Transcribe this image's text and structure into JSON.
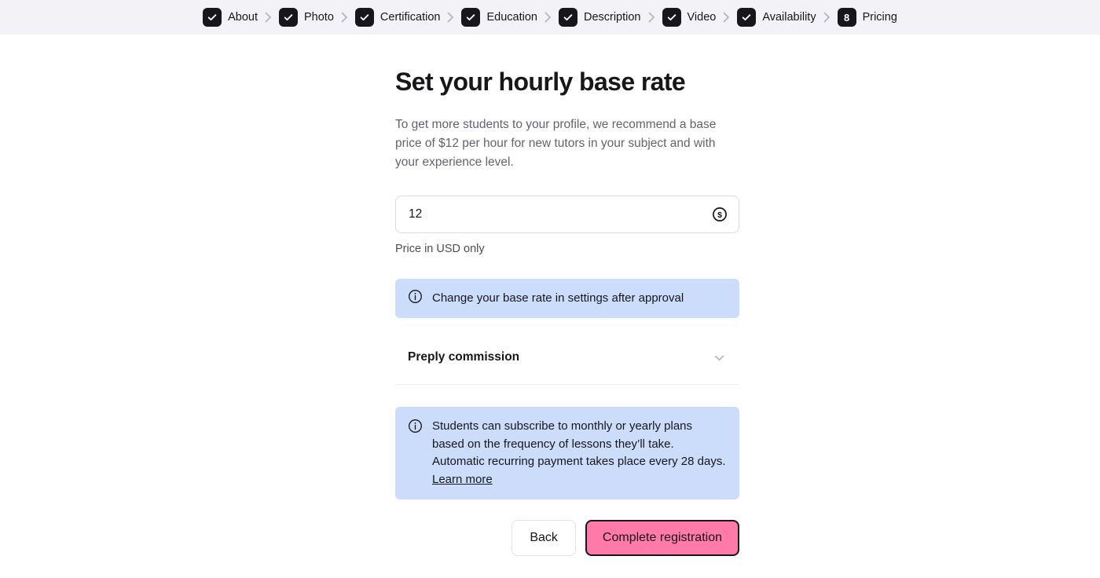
{
  "stepper": {
    "steps": [
      {
        "label": "About",
        "state": "done",
        "icon": "check-icon"
      },
      {
        "label": "Photo",
        "state": "done",
        "icon": "check-icon"
      },
      {
        "label": "Certification",
        "state": "done",
        "icon": "check-icon"
      },
      {
        "label": "Education",
        "state": "done",
        "icon": "check-icon"
      },
      {
        "label": "Description",
        "state": "done",
        "icon": "check-icon"
      },
      {
        "label": "Video",
        "state": "done",
        "icon": "check-icon"
      },
      {
        "label": "Availability",
        "state": "done",
        "icon": "check-icon"
      },
      {
        "label": "Pricing",
        "state": "current",
        "number": "8"
      }
    ],
    "separator_icon": "chevron-right-icon"
  },
  "main": {
    "title": "Set your hourly base rate",
    "subtitle": "To get more students to your profile, we recommend a base price of $12 per hour for new tutors in your subject and with your experience level.",
    "price": {
      "value": "12",
      "placeholder": "12",
      "icon": "dollar-coin-icon",
      "hint": "Price in USD only"
    },
    "banner_top": {
      "icon": "info-icon",
      "text": "Change your base rate in settings after approval"
    },
    "accordion": {
      "title": "Preply commission",
      "icon": "chevron-down-icon"
    },
    "banner_bottom": {
      "icon": "info-icon",
      "text": "Students can subscribe to monthly or yearly plans based on the frequency of lessons they’ll take. Automatic recurring payment takes place every 28 days. ",
      "link_label": "Learn more"
    },
    "actions": {
      "back_label": "Back",
      "submit_label": "Complete registration"
    }
  },
  "colors": {
    "header_bg": "#f2f2f7",
    "step_box": "#17161a",
    "banner_bg": "#ccddfb",
    "primary_button": "#ff7aa8",
    "primary_button_border": "#17161a",
    "text": "#17161a",
    "muted_text": "#63636f"
  }
}
